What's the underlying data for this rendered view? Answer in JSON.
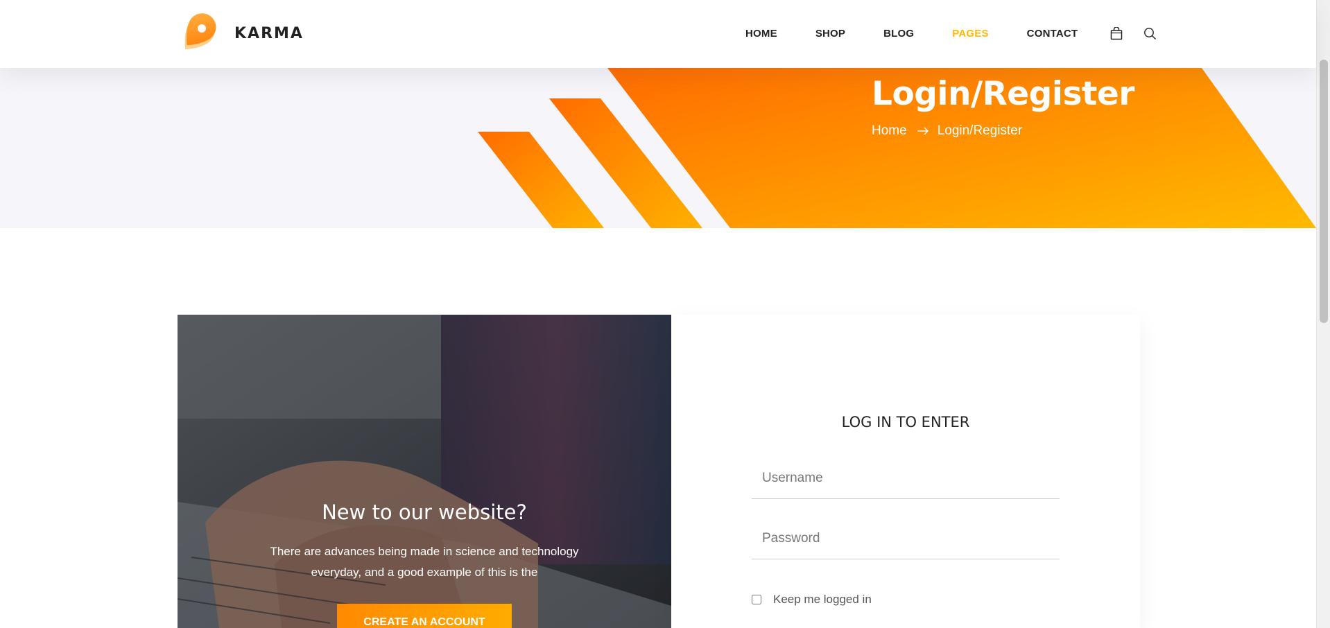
{
  "brand": {
    "name": "KARMA",
    "accent_color": "#ffba00",
    "accent_gradient": [
      "#ff6c00",
      "#ffba00"
    ]
  },
  "nav": {
    "items": [
      {
        "label": "HOME",
        "active": false
      },
      {
        "label": "SHOP",
        "active": false
      },
      {
        "label": "BLOG",
        "active": false
      },
      {
        "label": "PAGES",
        "active": true
      },
      {
        "label": "CONTACT",
        "active": false
      }
    ],
    "icons": [
      "shopping-bag-icon",
      "search-icon"
    ]
  },
  "banner": {
    "title": "Login/Register",
    "breadcrumb": {
      "home": "Home",
      "separator_icon": "arrow-right-icon",
      "current": "Login/Register"
    }
  },
  "promo": {
    "title": "New to our website?",
    "text": "There are advances being made in science and technology everyday, and a good example of this is the",
    "button_label": "CREATE AN ACCOUNT"
  },
  "login": {
    "title": "LOG IN TO ENTER",
    "username_placeholder": "Username",
    "password_placeholder": "Password",
    "remember_label": "Keep me logged in",
    "remember_checked": false
  }
}
